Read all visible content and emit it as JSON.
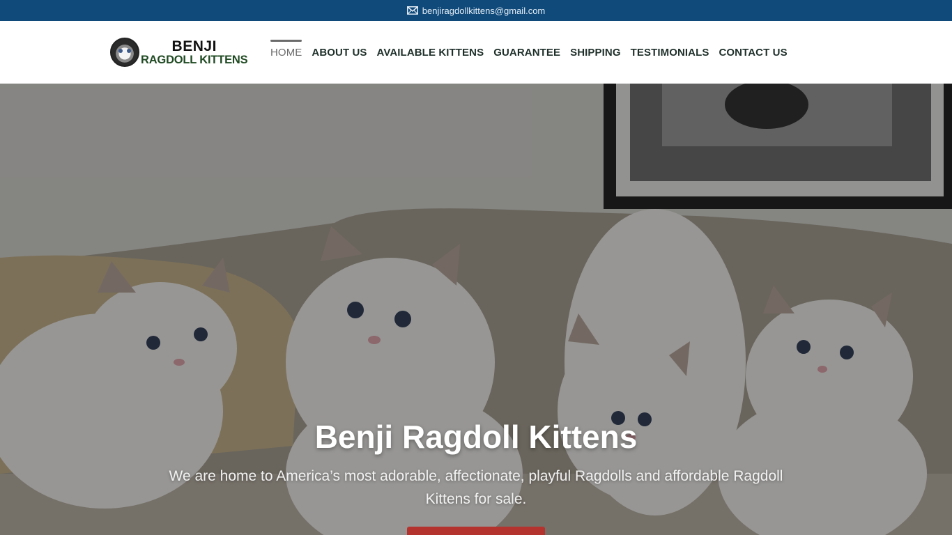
{
  "topbar": {
    "email": "benjiragdollkittens@gmail.com",
    "email_icon": "envelope-icon",
    "bg_color": "#0f4a7a"
  },
  "logo": {
    "line1": "BENJI",
    "line2": "RAGDOLL KITTENS"
  },
  "nav": {
    "items": [
      {
        "label": "HOME",
        "active": true
      },
      {
        "label": "ABOUT US",
        "active": false
      },
      {
        "label": "AVAILABLE KITTENS",
        "active": false
      },
      {
        "label": "GUARANTEE",
        "active": false
      },
      {
        "label": "SHIPPING",
        "active": false
      },
      {
        "label": "TESTIMONIALS",
        "active": false
      },
      {
        "label": "CONTACT US",
        "active": false
      }
    ]
  },
  "hero": {
    "title": "Benji Ragdoll Kittens",
    "subtitle": "We are home to America’s most adorable, affectionate, playful Ragdolls and affordable Ragdoll Kittens for sale.",
    "image_subject": "four white ragdoll kittens on a sofa",
    "cta_color": "#b5332e"
  }
}
